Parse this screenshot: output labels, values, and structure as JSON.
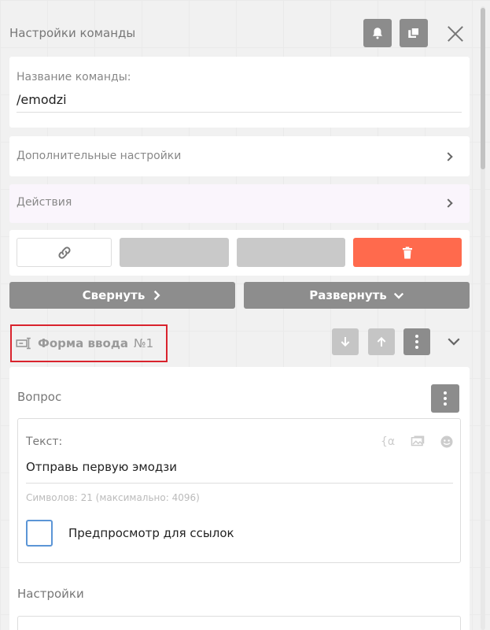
{
  "header": {
    "title": "Настройки команды"
  },
  "command_name": {
    "label": "Название команды:",
    "value": "/emodzi"
  },
  "sections": {
    "additional": "Дополнительные настройки",
    "actions": "Действия"
  },
  "controls": {
    "collapse": "Свернуть",
    "expand": "Развернуть"
  },
  "block": {
    "title": "Форма ввода",
    "number": "№1"
  },
  "question": {
    "label": "Вопрос",
    "text_label": "Текст:",
    "text_value": "Отправь первую эмодзи",
    "counter": "Символов: 21 (максимально: 4096)",
    "preview_label": "Предпросмотр для ссылок",
    "variables_icon_text": "{α"
  },
  "settings": {
    "label": "Настройки"
  },
  "colors": {
    "delete": "#ff6a4d",
    "highlight": "#d9232d",
    "checkbox": "#5b95d6"
  }
}
